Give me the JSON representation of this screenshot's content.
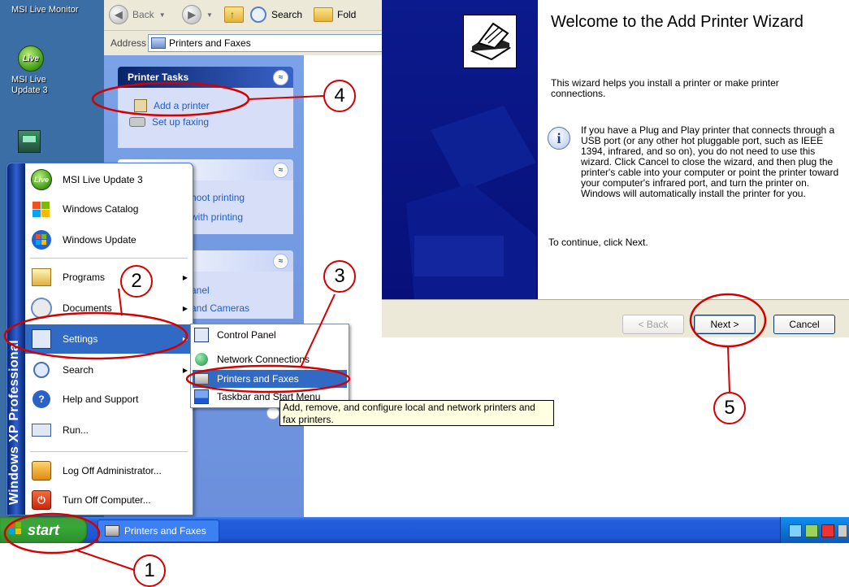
{
  "desktop": {
    "icons": [
      {
        "label": "MSI Live Monitor"
      },
      {
        "label": "MSI Live Update 3",
        "badge": "Live"
      }
    ]
  },
  "explorer": {
    "toolbar": {
      "back": "Back",
      "search": "Search",
      "folders": "Fold"
    },
    "address": {
      "label": "Address",
      "value": "Printers and Faxes"
    },
    "printer_tasks": {
      "title": "Printer Tasks",
      "items": [
        "Add a printer",
        "Set up faxing"
      ]
    },
    "troubleshoot": {
      "items": [
        "hoot printing",
        "with printing"
      ]
    },
    "see_also": {
      "heading": "s",
      "items": [
        "anel",
        "and Cameras"
      ]
    }
  },
  "startmenu": {
    "brand": "Windows XP Professional",
    "items": [
      {
        "label": "MSI Live Update 3",
        "badge": "Live"
      },
      {
        "label": "Windows Catalog"
      },
      {
        "label": "Windows Update"
      },
      {
        "label": "Programs"
      },
      {
        "label": "Documents"
      },
      {
        "label": "Settings"
      },
      {
        "label": "Search"
      },
      {
        "label": "Help and Support"
      },
      {
        "label": "Run..."
      },
      {
        "label": "Log Off Administrator..."
      },
      {
        "label": "Turn Off Computer..."
      }
    ]
  },
  "submenu": {
    "items": [
      {
        "label": "Control Panel"
      },
      {
        "label": "Network Connections"
      },
      {
        "label": "Printers and Faxes"
      },
      {
        "label": "Taskbar and Start Menu"
      }
    ]
  },
  "tooltip": "Add, remove, and configure local and network printers and fax printers.",
  "taskbar": {
    "start": "start",
    "task": "Printers and Faxes"
  },
  "wizard": {
    "title": "Welcome to the Add Printer Wizard",
    "intro": "This wizard helps you install a printer or make printer connections.",
    "info": "If you have a Plug and Play printer that connects through a USB port (or any other hot pluggable port, such as IEEE 1394, infrared, and so on), you do not need to use this wizard. Click Cancel to close the wizard, and then plug the printer's cable into your computer or point the printer toward your computer's infrared port, and turn the printer on. Windows will automatically install the printer for you.",
    "continue": "To continue, click Next.",
    "buttons": {
      "back": "< Back",
      "next": "Next >",
      "cancel": "Cancel"
    }
  },
  "annotations": [
    "1",
    "2",
    "3",
    "4",
    "5"
  ],
  "colors": {
    "annotation": "#d40000",
    "selection": "#316ac5",
    "xp_blue": "#245edb",
    "start_green": "#36a837"
  }
}
